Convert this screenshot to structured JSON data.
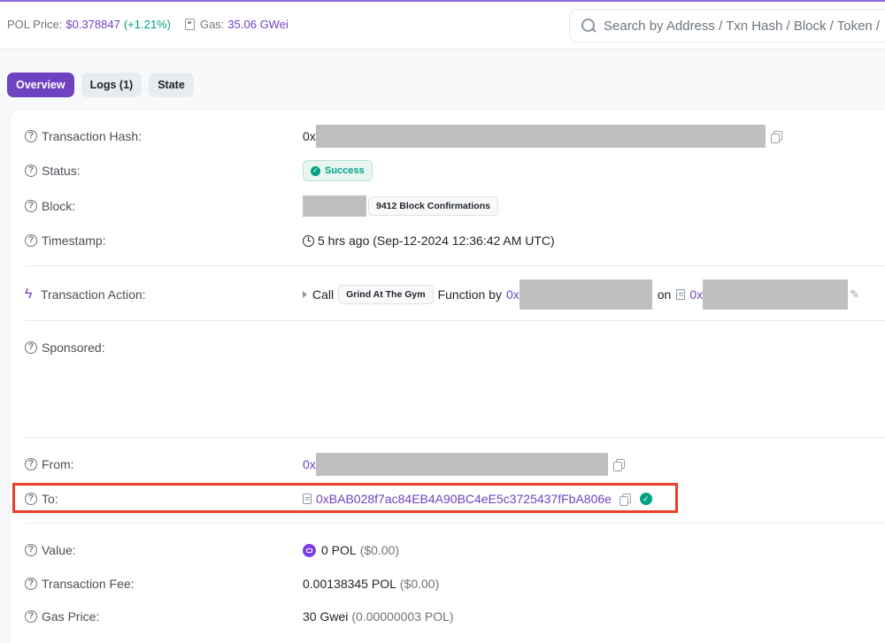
{
  "header": {
    "price_label": "POL Price:",
    "price_value": "$0.378847",
    "price_change": "(+1.21%)",
    "gas_label": "Gas:",
    "gas_value": "35.06 GWei",
    "gas_icon": "gas-pump-icon",
    "search_placeholder": "Search by Address / Txn Hash / Block / Token /",
    "search_icon": "search-icon"
  },
  "tabs": [
    {
      "label": "Overview",
      "active": true
    },
    {
      "label": "Logs (1)",
      "active": false
    },
    {
      "label": "State",
      "active": false
    }
  ],
  "details": {
    "tx_hash": {
      "label": "Transaction Hash:",
      "prefix": "0x"
    },
    "status": {
      "label": "Status:",
      "value": "Success"
    },
    "block": {
      "label": "Block:",
      "confirmations": "9412 Block Confirmations"
    },
    "timestamp": {
      "label": "Timestamp:",
      "value": "5 hrs ago (Sep-12-2024 12:36:42 AM UTC)"
    },
    "action": {
      "label": "Transaction Action:",
      "call": "Call",
      "function_name": "Grind At The Gym",
      "function_by": "Function by",
      "by_prefix": "0x",
      "on": "on",
      "on_prefix": "0x"
    },
    "sponsored": {
      "label": "Sponsored:"
    },
    "from": {
      "label": "From:",
      "prefix": "0x"
    },
    "to": {
      "label": "To:",
      "address": "0xBAB028f7ac84EB4A90BC4eE5c3725437fFbA806e"
    },
    "value": {
      "label": "Value:",
      "amount": "0 POL",
      "usd": "($0.00)"
    },
    "fee": {
      "label": "Transaction Fee:",
      "amount": "0.00138345 POL",
      "usd": "($0.00)"
    },
    "gas_price": {
      "label": "Gas Price:",
      "amount": "30 Gwei",
      "detail": "(0.00000003 POL)"
    }
  },
  "colors": {
    "accent": "#6f42c1",
    "success": "#00a186",
    "highlight_border": "#e8402b"
  }
}
